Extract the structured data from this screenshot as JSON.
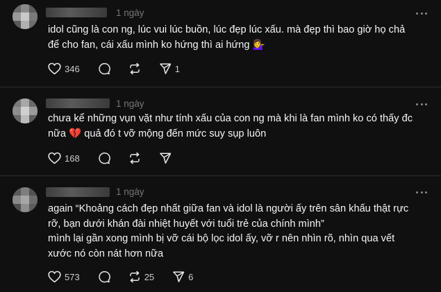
{
  "posts": [
    {
      "time": "1 ngày",
      "lines": [
        "idol cũng là con ng, lúc vui lúc buồn, lúc đẹp lúc xấu. mà đẹp thì bao giờ họ chả",
        "để cho fan, cái xấu mình ko hứng thì ai hứng 💁‍♀️"
      ],
      "likes": "346",
      "reposts": "",
      "shares": "1"
    },
    {
      "time": "1 ngày",
      "lines": [
        "chưa kể những vụn vặt như tính xấu của con ng mà khi là fan mình ko có thấy đc",
        "nữa 💔 quả đó t vỡ mộng đến mức suy sụp luôn"
      ],
      "likes": "168",
      "reposts": "",
      "shares": ""
    },
    {
      "time": "1 ngày",
      "lines": [
        "again “Khoảng cách đẹp nhất giữa fan và idol là người ấy trên sân khấu thật rực",
        "rỡ, bạn dưới khán đài nhiệt huyết với tuổi trẻ của chính mình”",
        "mình lại gần xong mình bị vỡ cái bộ lọc idol ấy, vỡ r nên nhìn rõ, nhìn qua vết",
        "xước nó còn nát hơn nữa"
      ],
      "likes": "573",
      "reposts": "25",
      "shares": "6"
    }
  ],
  "icons": {
    "like": "heart-icon",
    "reply": "comment-icon",
    "repost": "repost-icon",
    "share": "send-icon",
    "more": "more-icon"
  },
  "colors": {
    "background": "#101010",
    "text": "#f3f5f7",
    "muted": "#777777",
    "divider": "#2d2d2d"
  }
}
